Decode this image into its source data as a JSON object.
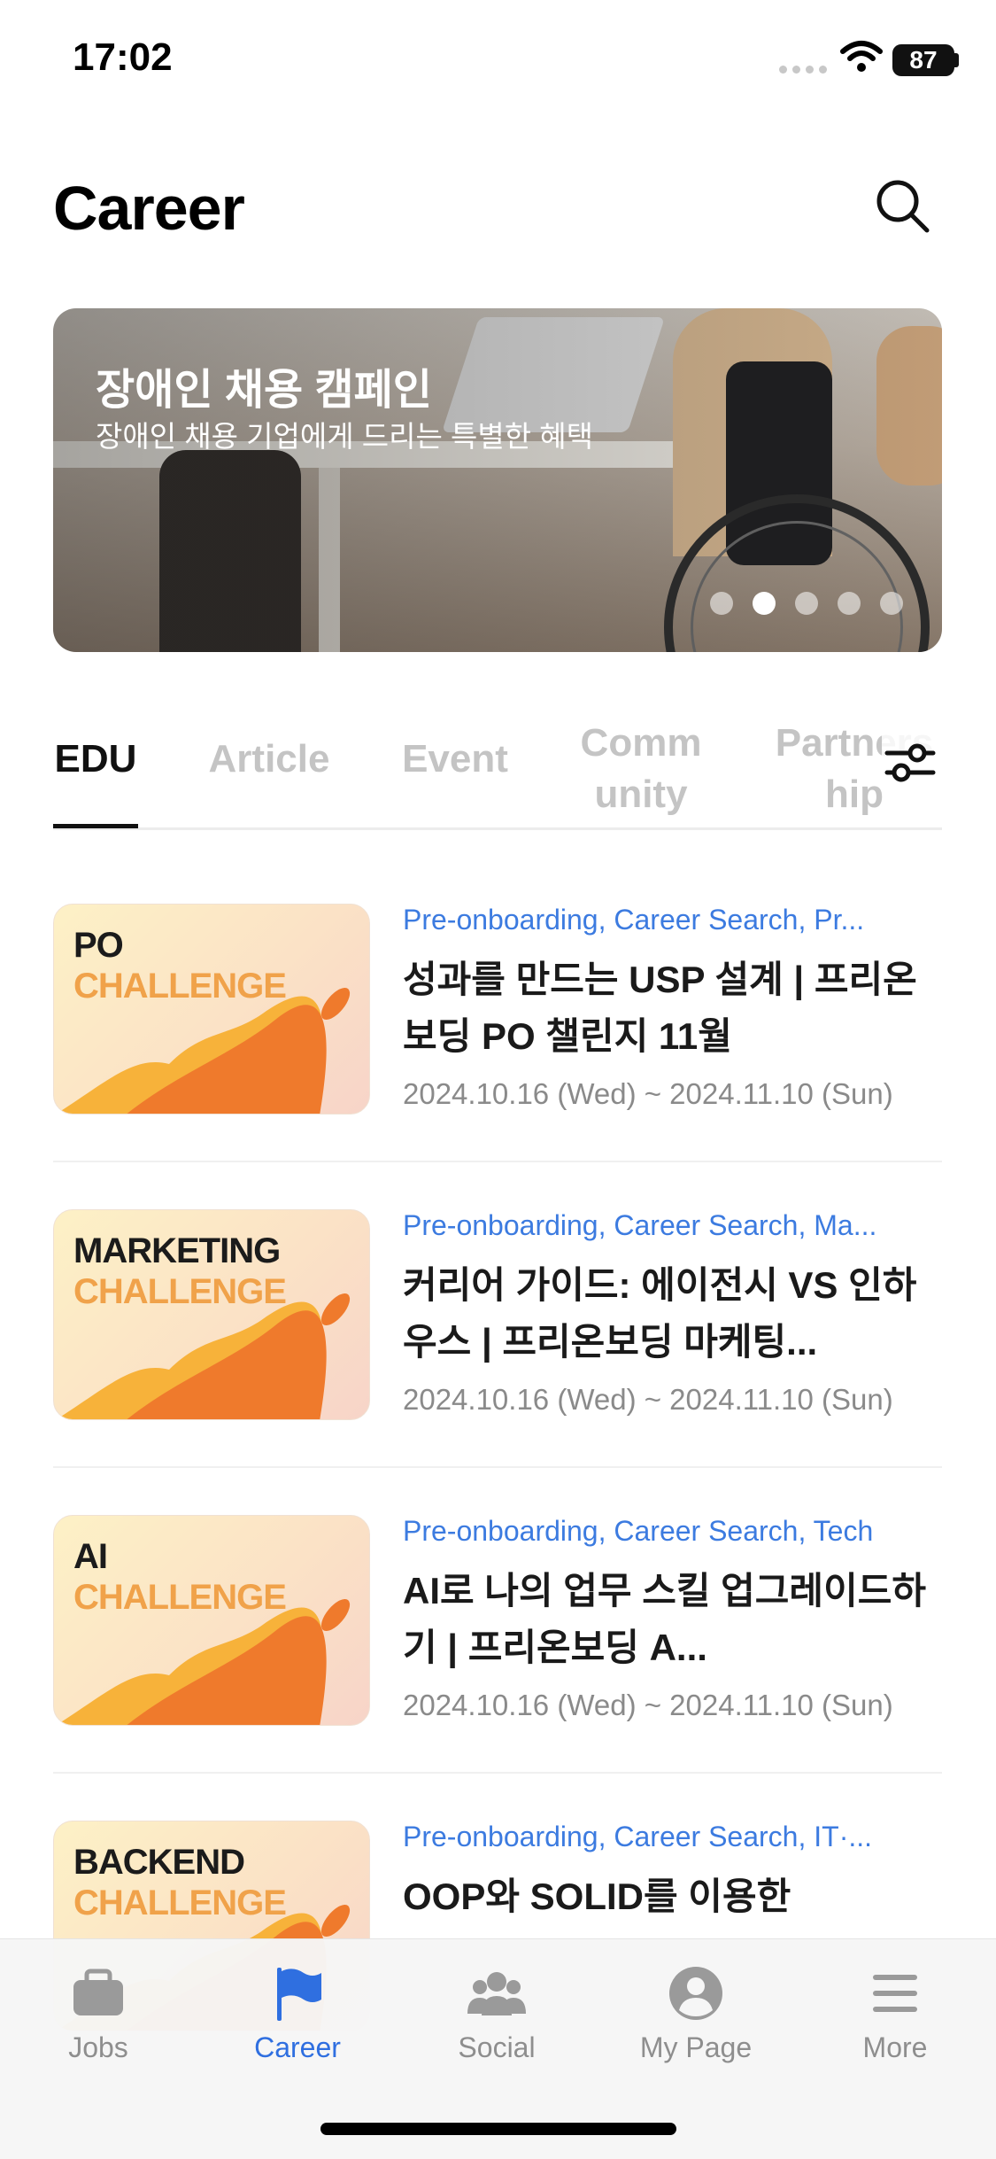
{
  "status_bar": {
    "time": "17:02",
    "battery": "87"
  },
  "header": {
    "title": "Career"
  },
  "banner": {
    "title": "장애인 채용 캠페인",
    "subtitle": "장애인 채용 기업에게 드리는 특별한 혜택",
    "dot_count": 5,
    "active_dot": 1
  },
  "tabs": [
    {
      "label": "EDU",
      "active": true
    },
    {
      "label": "Article",
      "active": false
    },
    {
      "label": "Event",
      "active": false
    },
    {
      "label": "Comm\nunity",
      "active": false
    },
    {
      "label": "Partners\nhip",
      "active": false
    }
  ],
  "items": [
    {
      "thumb_line1": "PO",
      "thumb_line2": "CHALLENGE",
      "categories": "Pre-onboarding, Career Search, Pr...",
      "title": "성과를 만드는 USP 설계 | 프리온보딩 PO 챌린지 11월",
      "date": "2024.10.16 (Wed) ~ 2024.11.10 (Sun)"
    },
    {
      "thumb_line1": "MARKETING",
      "thumb_line2": "CHALLENGE",
      "categories": "Pre-onboarding, Career Search, Ma...",
      "title": "커리어 가이드: 에이전시 VS 인하우스 | 프리온보딩 마케팅...",
      "date": "2024.10.16 (Wed) ~ 2024.11.10 (Sun)"
    },
    {
      "thumb_line1": "AI",
      "thumb_line2": "CHALLENGE",
      "categories": "Pre-onboarding, Career Search, Tech",
      "title": "AI로 나의 업무 스킬 업그레이드하기 | 프리온보딩 A...",
      "date": "2024.10.16 (Wed) ~ 2024.11.10 (Sun)"
    },
    {
      "thumb_line1": "BACKEND",
      "thumb_line2": "CHALLENGE",
      "categories": "Pre-onboarding, Career Search, IT·...",
      "title": "OOP와 SOLID를 이용한",
      "date": ""
    }
  ],
  "bottom_nav": [
    {
      "label": "Jobs",
      "icon": "briefcase-icon",
      "active": false
    },
    {
      "label": "Career",
      "icon": "flag-icon",
      "active": true
    },
    {
      "label": "Social",
      "icon": "people-icon",
      "active": false
    },
    {
      "label": "My Page",
      "icon": "profile-icon",
      "active": false
    },
    {
      "label": "More",
      "icon": "menu-icon",
      "active": false
    }
  ],
  "colors": {
    "accent": "#2f6fe0",
    "category_text": "#3c7be0",
    "inactive_tab": "#c4c4c4"
  }
}
